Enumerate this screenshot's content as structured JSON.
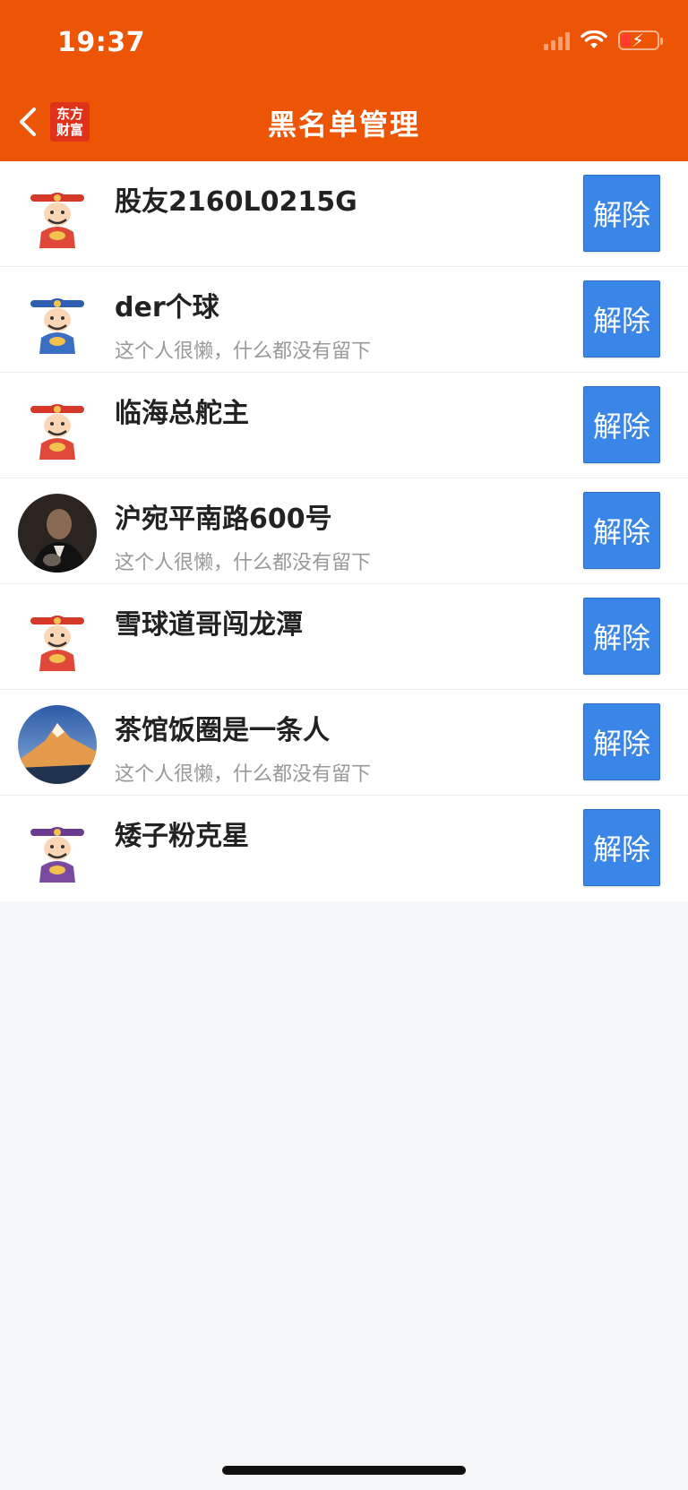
{
  "status_bar": {
    "time": "19:37"
  },
  "header": {
    "title": "黑名单管理",
    "brand_line1": "东方",
    "brand_line2": "财富"
  },
  "accent_colors": {
    "header": "#eb5505",
    "button": "#3a86e8"
  },
  "blacklist": [
    {
      "name": "股友2160L0215G",
      "bio": "",
      "avatar": "fortune-god-red-icon",
      "button": "解除"
    },
    {
      "name": "der个球",
      "bio": "这个人很懒，什么都没有留下",
      "avatar": "fortune-god-blue-icon",
      "button": "解除"
    },
    {
      "name": "临海总舵主",
      "bio": "",
      "avatar": "fortune-god-red-icon",
      "button": "解除"
    },
    {
      "name": "沪宛平南路600号",
      "bio": "这个人很懒，什么都没有留下",
      "avatar": "photo-portrait-icon",
      "button": "解除"
    },
    {
      "name": "雪球道哥闯龙潭",
      "bio": "",
      "avatar": "fortune-god-red-icon",
      "button": "解除"
    },
    {
      "name": "茶馆饭圈是一条人",
      "bio": "这个人很懒，什么都没有留下",
      "avatar": "photo-mountain-icon",
      "button": "解除"
    },
    {
      "name": "矮子粉克星",
      "bio": "",
      "avatar": "fortune-god-purple-icon",
      "button": "解除"
    }
  ]
}
